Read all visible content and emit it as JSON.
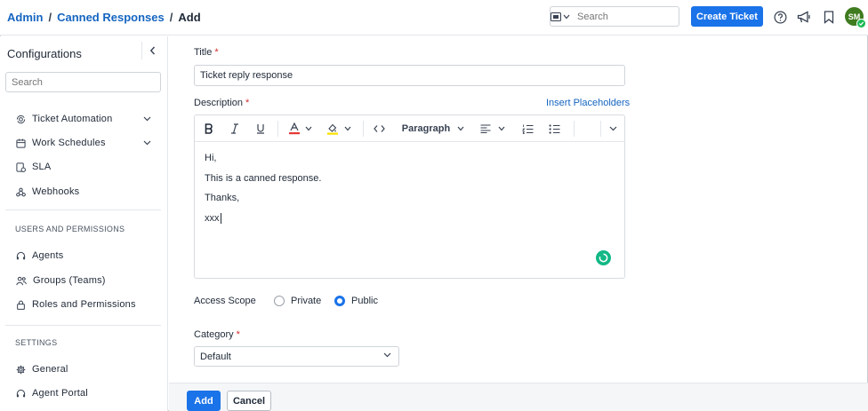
{
  "breadcrumb": {
    "admin": "Admin",
    "canned": "Canned Responses",
    "current": "Add",
    "separator": "/"
  },
  "header": {
    "search_placeholder": "Search",
    "create_ticket": "Create Ticket",
    "avatar_initials": "SM"
  },
  "sidebar": {
    "title": "Configurations",
    "search_placeholder": "Search",
    "items": [
      {
        "label": "Ticket Automation",
        "icon": "automation-icon"
      },
      {
        "label": "Work Schedules",
        "icon": "calendar-icon"
      },
      {
        "label": "SLA",
        "icon": "sla-icon"
      },
      {
        "label": "Webhooks",
        "icon": "webhook-icon"
      }
    ],
    "section_users": "USERS AND PERMISSIONS",
    "users_items": [
      {
        "label": "Agents",
        "icon": "headset-icon"
      },
      {
        "label": "Groups (Teams)",
        "icon": "group-icon"
      },
      {
        "label": "Roles and Permissions",
        "icon": "lock-icon"
      }
    ],
    "section_settings": "SETTINGS",
    "settings_items": [
      {
        "label": "General",
        "icon": "gear-icon"
      },
      {
        "label": "Agent Portal",
        "icon": "headset-icon"
      }
    ]
  },
  "form": {
    "title_label": "Title",
    "title_value": "Ticket reply response",
    "description_label": "Description",
    "insert_placeholders": "Insert Placeholders",
    "paragraph": "Paragraph",
    "body_lines": [
      "Hi,",
      "This is a canned response.",
      "Thanks,",
      "xxx"
    ],
    "access_scope_label": "Access Scope",
    "private_label": "Private",
    "public_label": "Public",
    "access_scope_selected": "Public",
    "category_label": "Category",
    "category_value": "Default",
    "required_mark": "*"
  },
  "footer": {
    "add": "Add",
    "cancel": "Cancel"
  },
  "colors": {
    "primary": "#1a73e8",
    "link": "#1565c0",
    "required": "#d32f2f",
    "avatar": "#3f7b1f",
    "font_color_bar": "#e53935",
    "highlight_bar": "#f9e000"
  }
}
